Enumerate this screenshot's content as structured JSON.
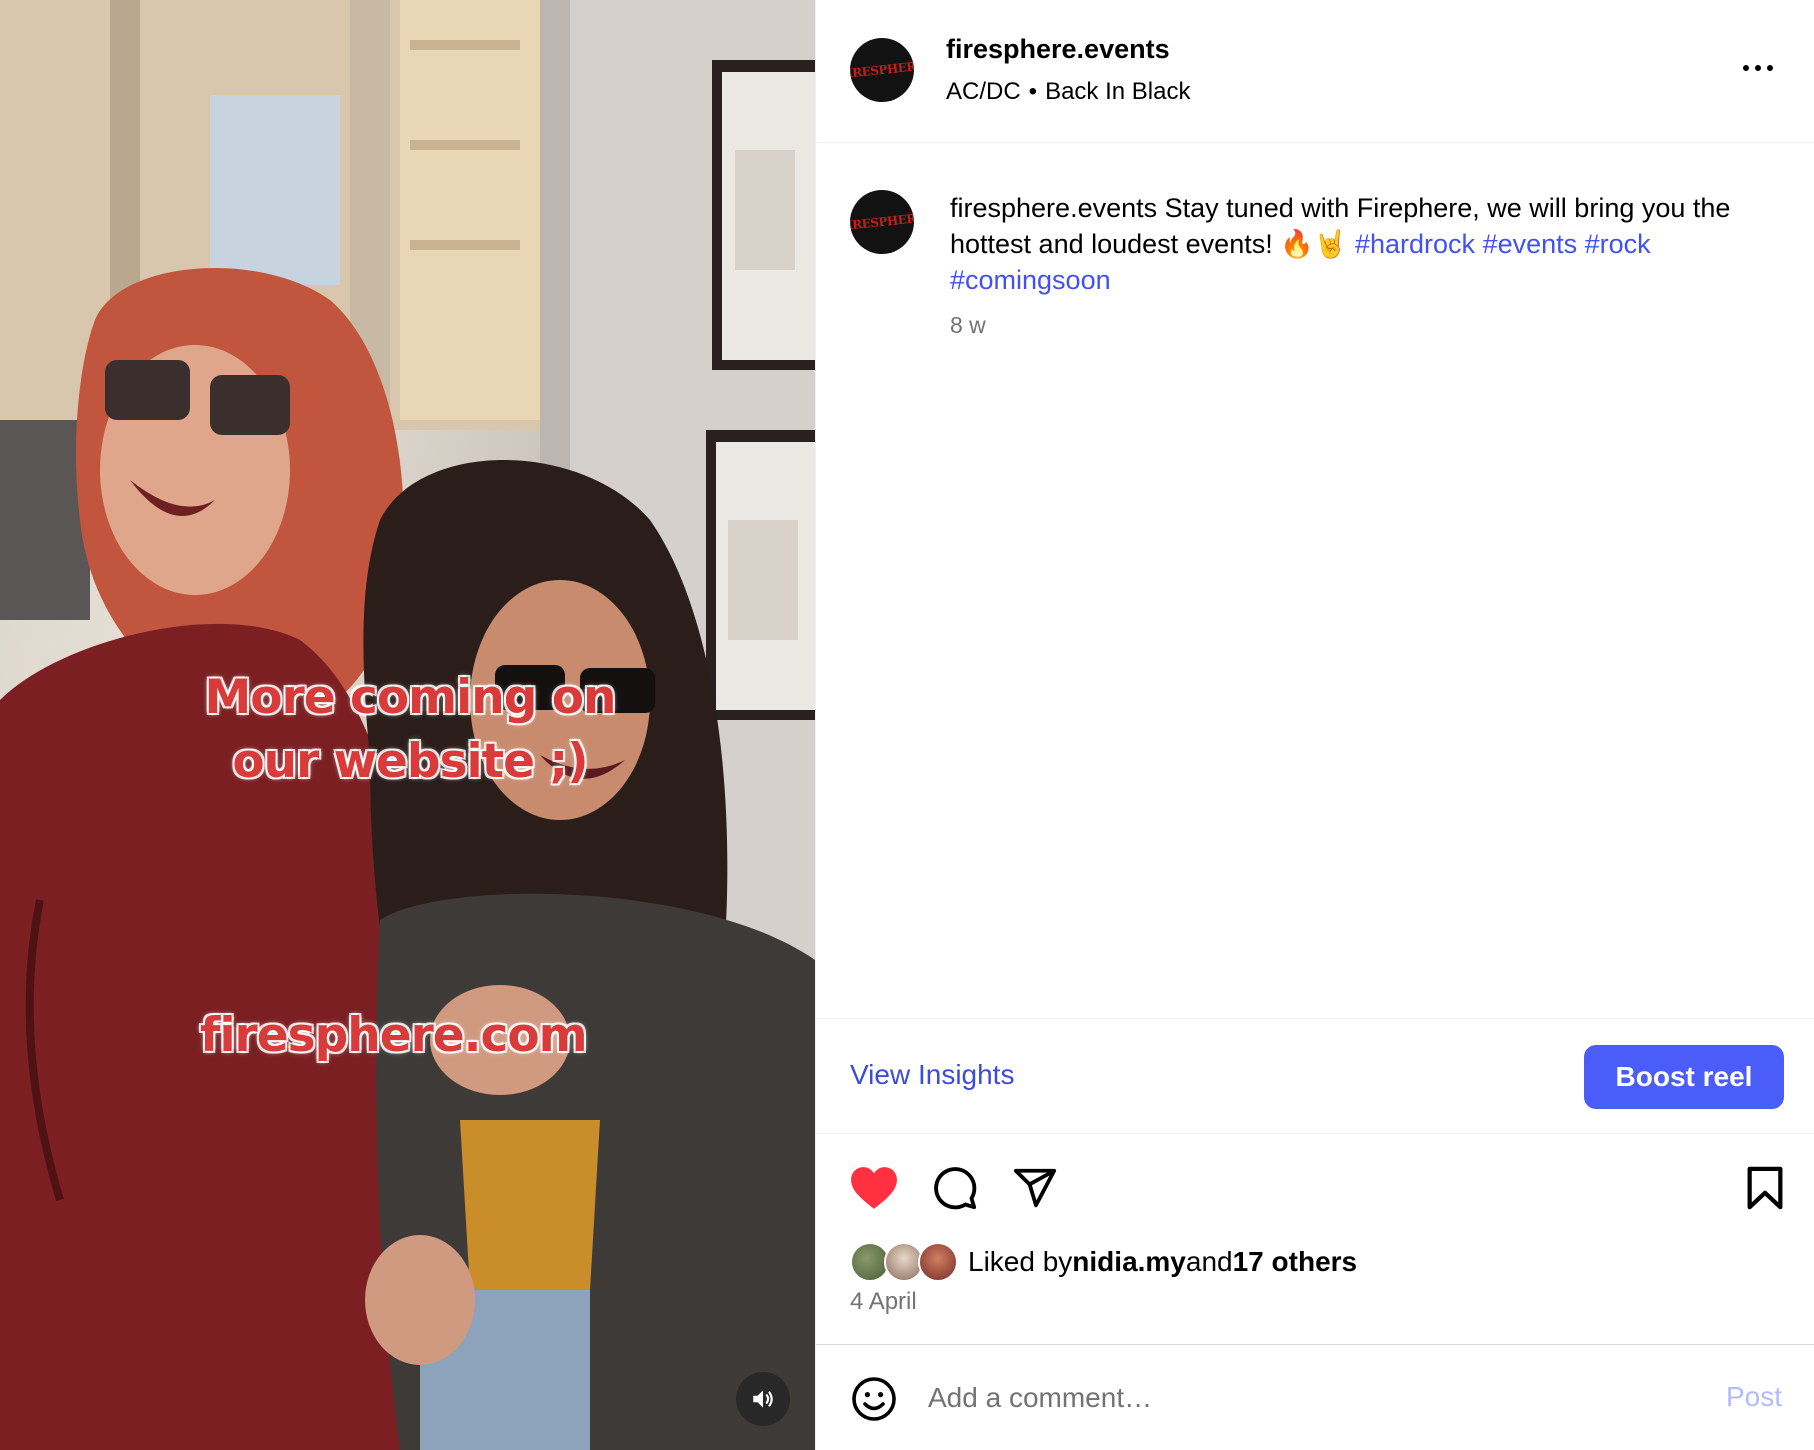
{
  "video": {
    "overlay_line1": "More coming on",
    "overlay_line2": "our website ;)",
    "overlay_site": "firesphere.com",
    "mute_icon": "speaker-on-icon"
  },
  "post": {
    "username": "firesphere.events",
    "avatar_logo": "FIRESPHERE",
    "song_artist": "AC/DC",
    "song_separator": "•",
    "song_title": "Back In Black",
    "more_icon": "more-horizontal-icon"
  },
  "caption": {
    "username": "firesphere.events",
    "text": " Stay tuned with Firephere, we will bring you the hottest and loudest events! 🔥🤘 ",
    "tags": [
      "#hardrock",
      "#events",
      "#rock",
      "#comingsoon"
    ],
    "time_ago": "8 w"
  },
  "insights": {
    "view_label": "View Insights",
    "boost_label": "Boost reel"
  },
  "actions": {
    "like_icon": "heart-filled-icon",
    "comment_icon": "comment-icon",
    "share_icon": "share-icon",
    "save_icon": "bookmark-icon",
    "like_color": "#ff3040"
  },
  "likes": {
    "prefix": "Liked by ",
    "user": "nidia.my",
    "middle": " and ",
    "others": "17 others",
    "date": "4 April"
  },
  "comment_box": {
    "emoji_icon": "emoji-icon",
    "placeholder": "Add a comment…",
    "post_label": "Post"
  }
}
